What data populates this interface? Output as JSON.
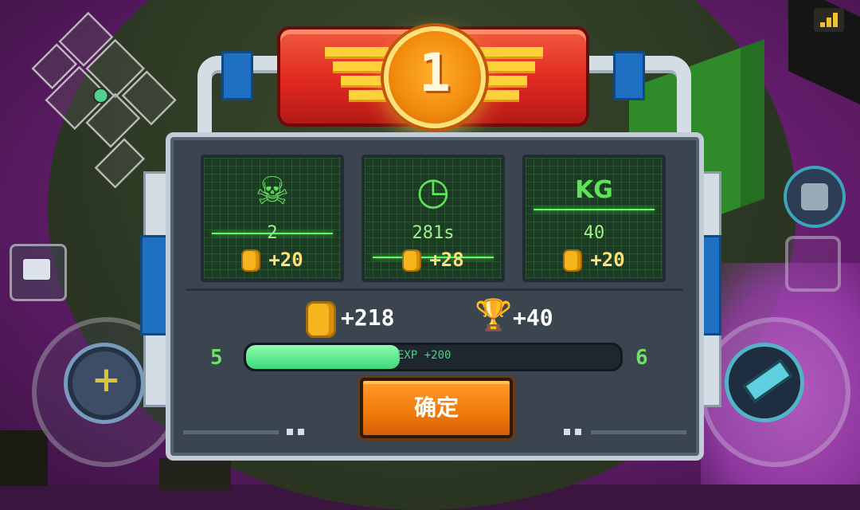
{
  "rank": {
    "value": "1"
  },
  "stats": [
    {
      "icon": "skull-crossbones-icon",
      "glyph": "☠",
      "value": "2",
      "reward": "+20"
    },
    {
      "icon": "clock-icon",
      "glyph": "◷",
      "value": "281s",
      "reward": "+28"
    },
    {
      "icon": "kg-weight-icon",
      "glyph": "KG",
      "value": "40",
      "reward": "+20"
    }
  ],
  "summary": {
    "gold": "+218",
    "trophy": "+40"
  },
  "level": {
    "current": "5",
    "next": "6",
    "exp_label": "EXP +200",
    "progress": 0.41
  },
  "confirm_label": "确定",
  "colors": {
    "accent_orange": "#f07a0c",
    "screen_green": "#60e25a",
    "gold": "#f6b51c",
    "banner_red": "#e0291f"
  }
}
